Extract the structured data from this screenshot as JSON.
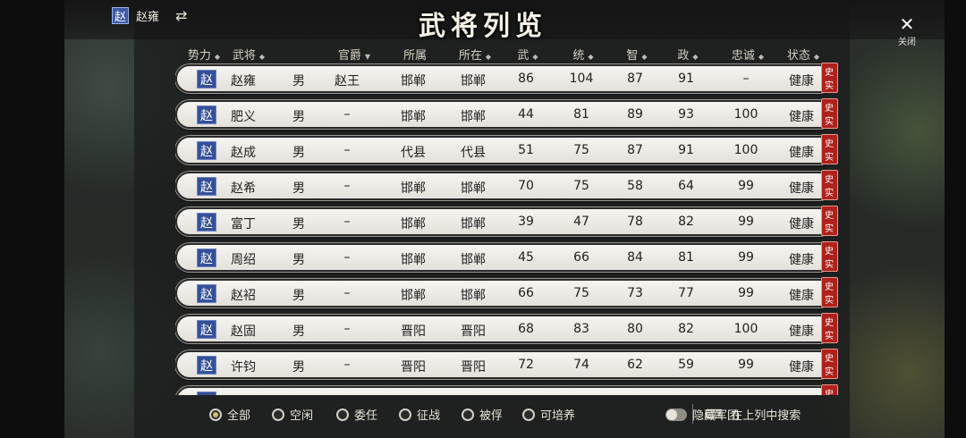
{
  "player": {
    "faction": "赵",
    "name": "赵雍"
  },
  "title": "武将列览",
  "close_label": "关闭",
  "columns": [
    {
      "key": "faction",
      "label": "势力",
      "sort": "◆"
    },
    {
      "key": "name",
      "label": "武将",
      "sort": "◆"
    },
    {
      "key": "gender",
      "label": "",
      "sort": ""
    },
    {
      "key": "title",
      "label": "官爵",
      "sort": "▼"
    },
    {
      "key": "home",
      "label": "所属",
      "sort": ""
    },
    {
      "key": "loc",
      "label": "所在",
      "sort": "◆"
    },
    {
      "key": "war",
      "label": "武",
      "sort": "◆"
    },
    {
      "key": "lead",
      "label": "统",
      "sort": "◆"
    },
    {
      "key": "int",
      "label": "智",
      "sort": "◆"
    },
    {
      "key": "pol",
      "label": "政",
      "sort": "◆"
    },
    {
      "key": "loyal",
      "label": "忠诚",
      "sort": "◆"
    },
    {
      "key": "status",
      "label": "状态",
      "sort": "◆"
    }
  ],
  "history_tag": "史实",
  "rows": [
    {
      "faction": "赵",
      "name": "赵雍",
      "gender": "男",
      "title": "赵王",
      "home": "邯郸",
      "loc": "邯郸",
      "war": "86",
      "lead": "104",
      "int": "87",
      "pol": "91",
      "loyal": "–",
      "status": "健康"
    },
    {
      "faction": "赵",
      "name": "肥义",
      "gender": "男",
      "title": "–",
      "home": "邯郸",
      "loc": "邯郸",
      "war": "44",
      "lead": "81",
      "int": "89",
      "pol": "93",
      "loyal": "100",
      "status": "健康"
    },
    {
      "faction": "赵",
      "name": "赵成",
      "gender": "男",
      "title": "–",
      "home": "代县",
      "loc": "代县",
      "war": "51",
      "lead": "75",
      "int": "87",
      "pol": "91",
      "loyal": "100",
      "status": "健康"
    },
    {
      "faction": "赵",
      "name": "赵希",
      "gender": "男",
      "title": "–",
      "home": "邯郸",
      "loc": "邯郸",
      "war": "70",
      "lead": "75",
      "int": "58",
      "pol": "64",
      "loyal": "99",
      "status": "健康"
    },
    {
      "faction": "赵",
      "name": "富丁",
      "gender": "男",
      "title": "–",
      "home": "邯郸",
      "loc": "邯郸",
      "war": "39",
      "lead": "47",
      "int": "78",
      "pol": "82",
      "loyal": "99",
      "status": "健康"
    },
    {
      "faction": "赵",
      "name": "周绍",
      "gender": "男",
      "title": "–",
      "home": "邯郸",
      "loc": "邯郸",
      "war": "45",
      "lead": "66",
      "int": "84",
      "pol": "81",
      "loyal": "99",
      "status": "健康"
    },
    {
      "faction": "赵",
      "name": "赵袑",
      "gender": "男",
      "title": "–",
      "home": "邯郸",
      "loc": "邯郸",
      "war": "66",
      "lead": "75",
      "int": "73",
      "pol": "77",
      "loyal": "99",
      "status": "健康"
    },
    {
      "faction": "赵",
      "name": "赵固",
      "gender": "男",
      "title": "–",
      "home": "晋阳",
      "loc": "晋阳",
      "war": "68",
      "lead": "83",
      "int": "80",
      "pol": "82",
      "loyal": "100",
      "status": "健康"
    },
    {
      "faction": "赵",
      "name": "许钧",
      "gender": "男",
      "title": "–",
      "home": "晋阳",
      "loc": "晋阳",
      "war": "72",
      "lead": "74",
      "int": "62",
      "pol": "59",
      "loyal": "99",
      "status": "健康"
    },
    {
      "faction": "赵",
      "name": "",
      "gender": "",
      "title": "",
      "home": "",
      "loc": "",
      "war": "",
      "lead": "",
      "int": "",
      "pol": "",
      "loyal": "",
      "status": ""
    }
  ],
  "filters": [
    {
      "label": "全部",
      "selected": true
    },
    {
      "label": "空闲",
      "selected": false
    },
    {
      "label": "委任",
      "selected": false
    },
    {
      "label": "征战",
      "selected": false
    },
    {
      "label": "被俘",
      "selected": false
    },
    {
      "label": "可培养",
      "selected": false
    }
  ],
  "hide_army_label": "隐藏军团",
  "search_label": "在上列中搜索"
}
